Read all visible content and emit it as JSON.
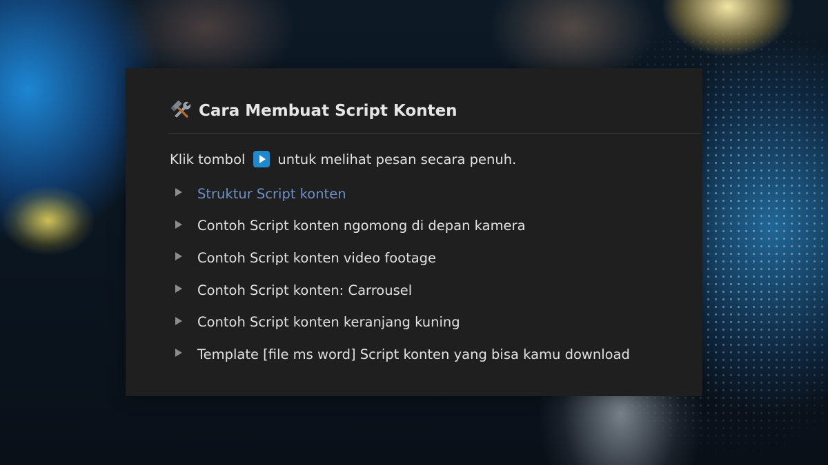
{
  "page": {
    "heading": "Cara Membuat Script Konten",
    "heading_icon": "hammer-and-wrench-icon",
    "intro_before": "Klik tombol",
    "intro_button_icon": "play-button-icon",
    "intro_after": "untuk melihat pesan secara penuh."
  },
  "toggles": [
    {
      "label": "Struktur Script konten",
      "highlighted": true
    },
    {
      "label": "Contoh Script konten ngomong di depan kamera",
      "highlighted": false
    },
    {
      "label": "Contoh Script konten video footage",
      "highlighted": false
    },
    {
      "label": "Contoh Script konten: Carrousel",
      "highlighted": false
    },
    {
      "label": "Contoh Script konten keranjang kuning",
      "highlighted": false
    },
    {
      "label": "Template [file ms word] Script konten yang bisa kamu download",
      "highlighted": false
    }
  ],
  "colors": {
    "card_background": "#1f1f1f",
    "text": "#e2e2e2",
    "link_highlight": "#6f8fc9",
    "play_button": "#1d8ad0",
    "toggle_arrow": "#8c8c8c"
  }
}
